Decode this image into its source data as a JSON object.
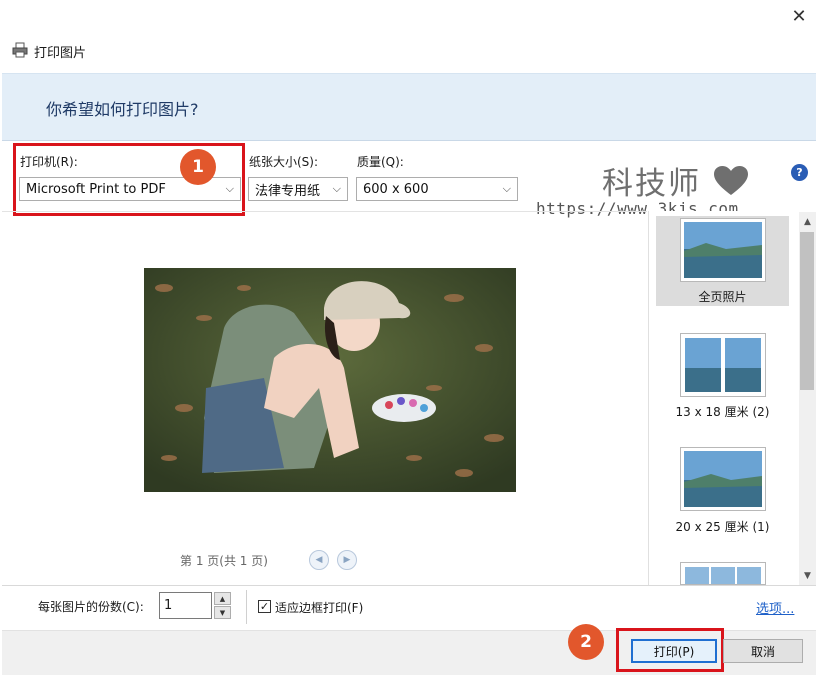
{
  "window": {
    "title": "打印图片",
    "close_glyph": "✕"
  },
  "banner": {
    "question": "你希望如何打印图片?"
  },
  "printer": {
    "label": "打印机(R):",
    "value": "Microsoft Print to PDF"
  },
  "paper": {
    "label": "纸张大小(S):",
    "value": "法律专用纸"
  },
  "quality": {
    "label": "质量(Q):",
    "value": "600 x 600"
  },
  "help": {
    "glyph": "?"
  },
  "watermark": {
    "text": "科技师",
    "url": "https://www.3kjs.com"
  },
  "badges": {
    "one": "1",
    "two": "2"
  },
  "preview": {
    "pager": "第 1 页(共 1 页)",
    "prev_glyph": "◀",
    "next_glyph": "▶"
  },
  "layouts": [
    {
      "label": "全页照片",
      "selected": true
    },
    {
      "label": "13 x 18 厘米 (2)",
      "selected": false
    },
    {
      "label": "20 x 25 厘米 (1)",
      "selected": false
    }
  ],
  "scroll": {
    "up_glyph": "▲",
    "down_glyph": "▼"
  },
  "copies": {
    "label": "每张图片的份数(C):",
    "value": "1",
    "up_glyph": "▲",
    "down_glyph": "▼"
  },
  "fit": {
    "label": "适应边框打印(F)",
    "checked_glyph": "✓"
  },
  "options_link": "选项...",
  "buttons": {
    "print": "打印(P)",
    "cancel": "取消"
  },
  "colors": {
    "highlight_red": "#d9141b",
    "badge_orange": "#e2572c",
    "banner_bg": "#e3eef8",
    "link_blue": "#1e60c8"
  },
  "icons": {
    "window": "printer-icon",
    "help": "help-icon",
    "heart": "heart-icon"
  }
}
